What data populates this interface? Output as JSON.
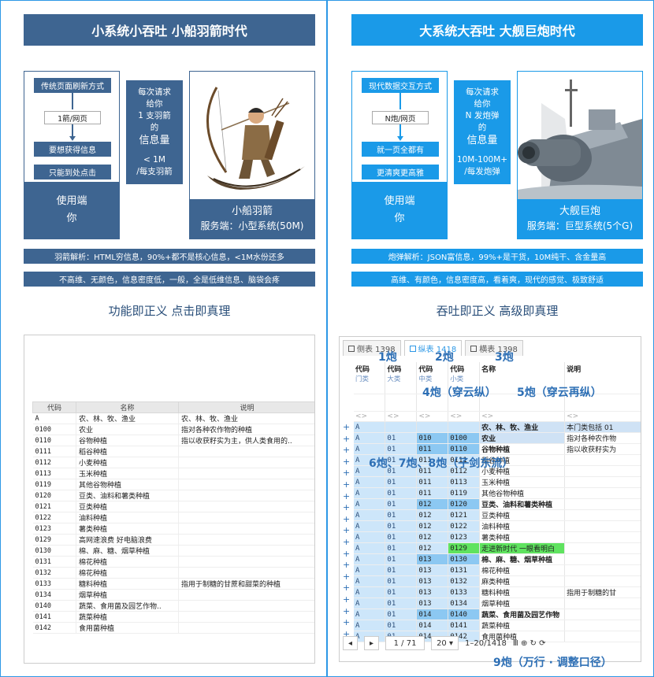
{
  "colors": {
    "navy": "#3e6591",
    "blue": "#1a9ae8",
    "green_row": "#5fe35f",
    "sel_blue": "#8cc8f2",
    "pale_blue": "#cde6fa"
  },
  "left": {
    "title": "小系统小吞吐 小船羽箭时代",
    "flow": [
      "传统页面刷新方式",
      "1箭/网页",
      "要想获得信息",
      "只能到处点击"
    ],
    "side_lines": [
      "使用端",
      "你"
    ],
    "mid_lines": [
      "每次请求",
      "给你",
      "1 支羽箭",
      "的"
    ],
    "mid_big": "信息量",
    "mid_bottom": [
      "< 1M",
      "/每支羽箭"
    ],
    "img_caption": [
      "小船羽箭",
      "服务端：小型系统(50M)"
    ],
    "bar1": "羽箭解析：HTML穷信息，90%+都不是核心信息，<1M水份还多",
    "bar2": "不高维、无颜色，信息密度低，一般，全是低维信息、脑袋会疼",
    "subtitle": "功能即正义 点击即真理",
    "table": {
      "headers": [
        "代码",
        "名称",
        "说明"
      ],
      "rows": [
        [
          "A",
          "农、林、牧、渔业",
          "农、林、牧、渔业"
        ],
        [
          "0100",
          "农业",
          "指对各种农作物的种植"
        ],
        [
          "0110",
          "谷物种植",
          "指以收获籽实为主，供人类食用的.."
        ],
        [
          "0111",
          "稻谷种植",
          ""
        ],
        [
          "0112",
          "小麦种植",
          ""
        ],
        [
          "0113",
          "玉米种植",
          ""
        ],
        [
          "0119",
          "其他谷物种植",
          ""
        ],
        [
          "0120",
          "豆类、油料和薯类种植",
          ""
        ],
        [
          "0121",
          "豆类种植",
          ""
        ],
        [
          "0122",
          "油料种植",
          ""
        ],
        [
          "0123",
          "薯类种植",
          ""
        ],
        [
          "0129",
          "高网速浪费 好电脑浪费",
          ""
        ],
        [
          "0130",
          "棉、麻、糖、烟草种植",
          ""
        ],
        [
          "0131",
          "棉花种植",
          ""
        ],
        [
          "0132",
          "棉花种植",
          ""
        ],
        [
          "0133",
          "糖料种植",
          "指用于制糖的甘蔗和甜菜的种植"
        ],
        [
          "0134",
          "烟草种植",
          ""
        ],
        [
          "0140",
          "蔬菜、食用菌及园艺作物..",
          ""
        ],
        [
          "0141",
          "蔬菜种植",
          ""
        ],
        [
          "0142",
          "食用菌种植",
          ""
        ]
      ]
    }
  },
  "right": {
    "title": "大系统大吞吐 大舰巨炮时代",
    "flow": [
      "现代数据交互方式",
      "N炮/网页",
      "就一页全都有",
      "更清爽更高雅"
    ],
    "side_lines": [
      "使用端",
      "你"
    ],
    "mid_lines": [
      "每次请求",
      "给你",
      "N 发炮弹",
      "的"
    ],
    "mid_big": "信息量",
    "mid_bottom": [
      "10M-100M+",
      "/每发炮弹"
    ],
    "img_caption": [
      "大舰巨炮",
      "服务端：巨型系统(5个G)"
    ],
    "bar1": "炮弹解析：JSON富信息，99%+是干货，10M纯干、含金量高",
    "bar2": "高维、有颜色，信息密度高，看着爽，现代的感觉、极致舒适",
    "subtitle": "吞吐即正义 高级即真理",
    "tabs": [
      "侧表 1398",
      "纵表 1418",
      "横表 1398"
    ],
    "grid": {
      "h1": [
        "代码",
        "代码",
        "代码",
        "代码",
        "名称",
        "说明"
      ],
      "h2": [
        "门类",
        "大类",
        "中类",
        "小类",
        "",
        ""
      ],
      "filter": "<>",
      "rows": [
        [
          "A",
          "",
          "",
          "",
          "农、林、牧、渔业",
          "本门类包括 01"
        ],
        [
          "A",
          "01",
          "010",
          "0100",
          "农业",
          "指对各种农作物"
        ],
        [
          "A",
          "01",
          "011",
          "0110",
          "谷物种植",
          "指以收获籽实为"
        ],
        [
          "A",
          "01",
          "011",
          "0111",
          "稻谷种植",
          ""
        ],
        [
          "A",
          "01",
          "011",
          "0112",
          "小麦种植",
          ""
        ],
        [
          "A",
          "01",
          "011",
          "0113",
          "玉米种植",
          ""
        ],
        [
          "A",
          "01",
          "011",
          "0119",
          "其他谷物种植",
          ""
        ],
        [
          "A",
          "01",
          "012",
          "0120",
          "豆类、油料和薯类种植",
          ""
        ],
        [
          "A",
          "01",
          "012",
          "0121",
          "豆类种植",
          ""
        ],
        [
          "A",
          "01",
          "012",
          "0122",
          "油料种植",
          ""
        ],
        [
          "A",
          "01",
          "012",
          "0123",
          "薯类种植",
          ""
        ],
        [
          "A",
          "01",
          "012",
          "0129",
          "走进新时代 一眼看明白",
          ""
        ],
        [
          "A",
          "01",
          "013",
          "0130",
          "棉、麻、糖、烟草种植",
          ""
        ],
        [
          "A",
          "01",
          "013",
          "0131",
          "棉花种植",
          ""
        ],
        [
          "A",
          "01",
          "013",
          "0132",
          "麻类种植",
          ""
        ],
        [
          "A",
          "01",
          "013",
          "0133",
          "糖料种植",
          "指用于制糖的甘"
        ],
        [
          "A",
          "01",
          "013",
          "0134",
          "烟草种植",
          ""
        ],
        [
          "A",
          "01",
          "014",
          "0140",
          "蔬菜、食用菌及园艺作物",
          ""
        ],
        [
          "A",
          "01",
          "014",
          "0141",
          "蔬菜种植",
          ""
        ],
        [
          "A",
          "01",
          "014",
          "0142",
          "食用菌种植",
          ""
        ]
      ]
    },
    "pager": {
      "prev": "◂",
      "next": "▸",
      "page": "1 / 71",
      "size": "20 ▾",
      "range": "1–20/1418",
      "icons": "Ⅲ  ⊕  ↻  ⟳"
    },
    "annotations": [
      "1炮",
      "2炮",
      "3炮",
      "4炮（穿云纵）",
      "5炮（穿云再纵）",
      "6炮、7炮、8炮（子剑东流）",
      "9炮（万行 · 调整口径）"
    ]
  }
}
